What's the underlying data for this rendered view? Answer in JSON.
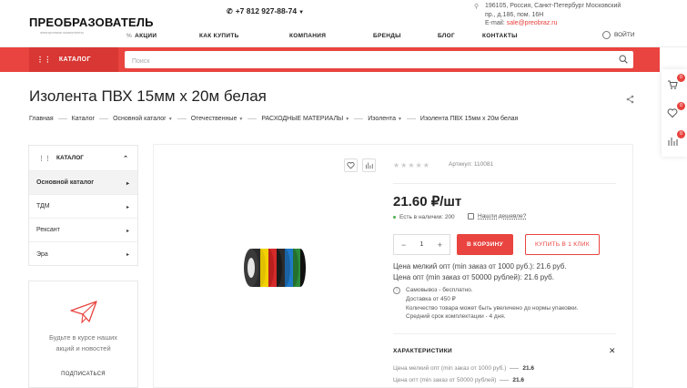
{
  "header": {
    "logo": "ПРЕОБРАЗОВАТЕЛЬ",
    "logo_sub": "электронные компоненты",
    "phone": "+7 812 927-88-74",
    "address_lines": [
      "196105, Россия, Санкт-Петербург Московский",
      "пр., д.186, пом. 16Н"
    ],
    "email_label": "E-mail: ",
    "email": "sale@preobraz.ru",
    "menu": [
      "АКЦИИ",
      "КАК КУПИТЬ",
      "КОМПАНИЯ",
      "БРЕНДЫ",
      "БЛОГ",
      "КОНТАКТЫ"
    ],
    "login": "ВОЙТИ"
  },
  "catalog_button": "КАТАЛОГ",
  "search": {
    "placeholder": "Поиск"
  },
  "side_panel": {
    "cart_count": "0",
    "favorites_count": "0",
    "compare_count": "0"
  },
  "page": {
    "title": "Изолента ПВХ 15мм x 20м белая",
    "breadcrumbs": [
      "Главная",
      "Каталог",
      "Основной каталог",
      "Отечественные",
      "РАСХОДНЫЕ МАТЕРИАЛЫ",
      "Изолента",
      "Изолента ПВХ 15мм x 20м белая"
    ]
  },
  "sidebar": {
    "title": "КАТАЛОГ",
    "items": [
      {
        "label": "Основной каталог"
      },
      {
        "label": "ТДМ"
      },
      {
        "label": "Рексант"
      },
      {
        "label": "Эра"
      }
    ]
  },
  "subscribe": {
    "text_line1": "Будьте в курсе наших",
    "text_line2": "акций и новостей",
    "button": "ПОДПИСАТЬСЯ"
  },
  "product": {
    "article_label": "Артикул: ",
    "article": "110081",
    "price": "21.60 ₽/шт",
    "stock": "Есть в наличии: 200",
    "cheaper": "Нашли дешевле?",
    "quantity": "1",
    "to_cart": "В КОРЗИНУ",
    "one_click": "КУПИТЬ В 1 КЛИК",
    "price_small": "Цена мелкий опт (min заказ от 1000 руб.): 21.6 руб.",
    "price_opt": "Цена опт (min заказ от 50000 рублей): 21.6 руб.",
    "delivery": [
      "Самовывоз - бесплатно.",
      "Доставка от 450 ₽",
      "Количество товара может быть увеличено до нормы упаковки.",
      "Средний срок комплектации - 4 дня."
    ],
    "chars_title": "ХАРАКТЕРИСТИКИ",
    "chars": [
      {
        "name": "Цена мелкий опт (min заказ от 1000 руб.)",
        "value": "21.6"
      },
      {
        "name": "Цена опт (min заказ от 50000 рублей)",
        "value": "21.6"
      }
    ]
  },
  "colors": {
    "accent": "#e9443f",
    "accent_dark": "#d83733",
    "stock_green": "#4caf50"
  }
}
